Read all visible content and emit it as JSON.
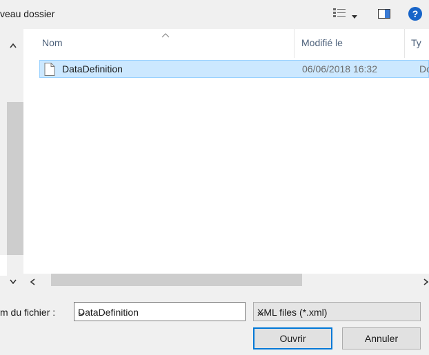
{
  "toolbar": {
    "new_folder_label": "veau dossier"
  },
  "columns": {
    "name": "Nom",
    "modified": "Modifié le",
    "type": "Ty"
  },
  "files": [
    {
      "name": "DataDefinition",
      "modified": "06/06/2018 16:32",
      "type": "Do"
    }
  ],
  "form": {
    "filename_label": "m du fichier :",
    "filename_value": "DataDefinition",
    "filetype_value": "XML files (*.xml)",
    "open_label": "Ouvrir",
    "cancel_label": "Annuler"
  },
  "icons": {
    "view": "view-list-icon",
    "pane": "preview-pane-icon",
    "help": "help-icon"
  },
  "colors": {
    "selection": "#cce8ff",
    "accent": "#0078d7",
    "help": "#1764c8"
  }
}
